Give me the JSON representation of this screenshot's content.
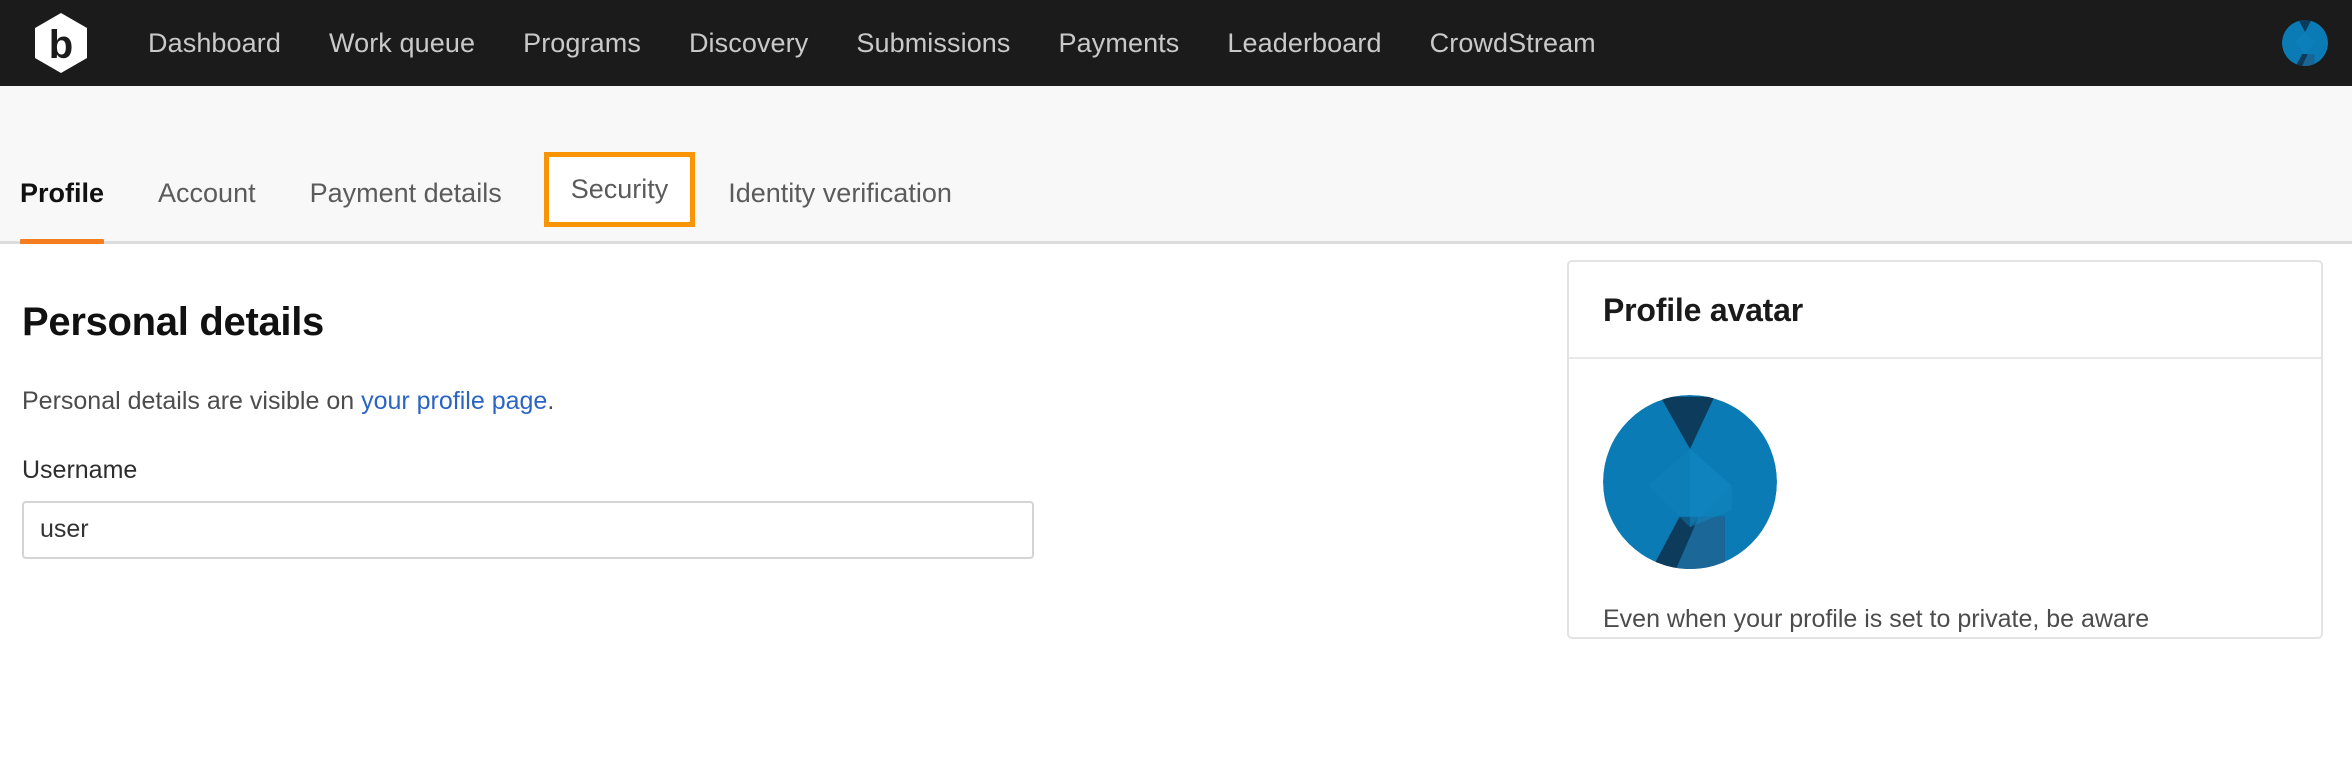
{
  "brand": {
    "logo_icon": "bugcrowd-hexagon-b-logo",
    "accent_orange": "#f47d20",
    "focus_orange": "#f89406",
    "navbar_bg": "#1b1b1b",
    "avatar_blue": "#0b7bb5",
    "avatar_navy": "#0d3b5c",
    "link_blue": "#2a65c4"
  },
  "navbar": {
    "links": [
      {
        "label": "Dashboard"
      },
      {
        "label": "Work queue"
      },
      {
        "label": "Programs"
      },
      {
        "label": "Discovery"
      },
      {
        "label": "Submissions"
      },
      {
        "label": "Payments"
      },
      {
        "label": "Leaderboard"
      },
      {
        "label": "CrowdStream"
      }
    ],
    "avatar_icon": "user-avatar-identicon"
  },
  "tabs": [
    {
      "label": "Profile",
      "active": true,
      "focused": false
    },
    {
      "label": "Account",
      "active": false,
      "focused": false
    },
    {
      "label": "Payment details",
      "active": false,
      "focused": false
    },
    {
      "label": "Security",
      "active": false,
      "focused": true
    },
    {
      "label": "Identity verification",
      "active": false,
      "focused": false
    }
  ],
  "main": {
    "title": "Personal details",
    "description_prefix": "Personal details are visible on ",
    "description_link": "your profile page",
    "description_suffix": ".",
    "username_label": "Username",
    "username_value": "user",
    "username_placeholder": "Username"
  },
  "avatar_card": {
    "title": "Profile avatar",
    "avatar_icon": "profile-avatar-identicon",
    "note": "Even when your profile is set to private, be aware"
  }
}
